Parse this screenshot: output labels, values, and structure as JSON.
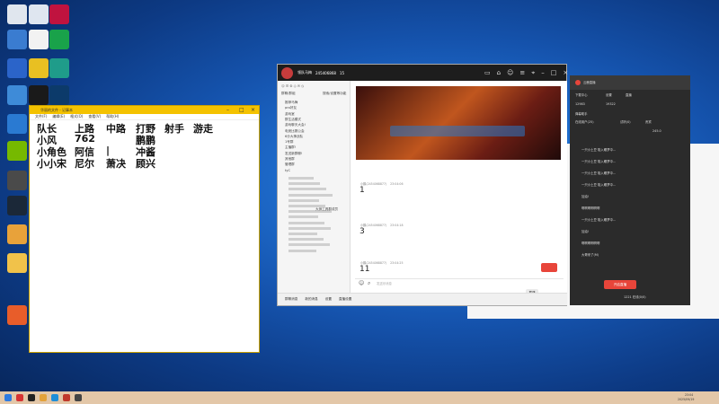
{
  "desktop": {
    "icons": [
      {
        "name": "recycle-bin-icon",
        "color": "#e0e6ee"
      },
      {
        "name": "document-icon",
        "color": "#dfe6f0"
      },
      {
        "name": "app-red-icon",
        "color": "#c0133f"
      },
      {
        "name": "pc-icon",
        "color": "#3a7cd0"
      },
      {
        "name": "folder-icon",
        "color": "#f2f2f2"
      },
      {
        "name": "qq-music-icon",
        "color": "#19a24a"
      },
      {
        "name": "shield-icon",
        "color": "#2b64c9"
      },
      {
        "name": "chrome-icon",
        "color": "#e8c022"
      },
      {
        "name": "game-icon",
        "color": "#1f9c8a"
      },
      {
        "name": "photo-icon",
        "color": "#3e8bd8"
      },
      {
        "name": "media-icon",
        "color": "#1a1a1a"
      },
      {
        "name": "power-icon",
        "color": "#0c3a6a"
      },
      {
        "name": "phone-icon",
        "color": "#2a7ad2"
      },
      {
        "name": "edge-icon",
        "color": "#2a9bd8"
      },
      {
        "name": "nvidia-icon",
        "color": "#76b900"
      },
      {
        "name": "colorful-icon",
        "color": "#d63b4b"
      },
      {
        "name": "gear-icon",
        "color": "#4a4a4a"
      },
      {
        "name": "bilibili-icon",
        "color": "#23aee5"
      },
      {
        "name": "steam-icon",
        "color": "#1b2838"
      },
      {
        "name": "netease-icon",
        "color": "#c62f2f"
      },
      {
        "name": "pubg-icon",
        "color": "#e8a23a"
      },
      {
        "name": "obs-icon",
        "color": "#302e31"
      },
      {
        "name": "folder2-icon",
        "color": "#f1c24a"
      },
      {
        "name": "app-red2-icon",
        "color": "#cc2222"
      },
      {
        "name": "app-orange-icon",
        "color": "#e85d2a"
      }
    ]
  },
  "notepad": {
    "title": "华丽的文件 - 记事本",
    "menu": [
      "文件(F)",
      "编辑(E)",
      "格式(O)",
      "查看(V)",
      "帮助(H)"
    ],
    "lines": [
      [
        "队长",
        "上路",
        "中路",
        "打野",
        "射手",
        "游走"
      ],
      [
        "小风",
        "762",
        "",
        "鹏鹏",
        "",
        ""
      ],
      [
        "小角色",
        "阿信",
        "|",
        "冲酱",
        "",
        ""
      ],
      [
        "小小宋",
        "尼尔",
        "萧决",
        "顾兴",
        "",
        ""
      ]
    ]
  },
  "qq": {
    "title": "领队马梅",
    "group_id": "245406868",
    "group_count": "15",
    "left_header": "群聊/群组",
    "left_search": "搜索/设置等功能",
    "groups": [
      "推荐马梅",
      "pro好友",
      "游戏室",
      "群生活模式",
      "游戏聊天大会!",
      "电竞比赛公会",
      "6分大神战队",
      "1号群",
      "主播群!",
      "发送新群聊!",
      "其他群",
      "管理群",
      "tyC"
    ],
    "members_label": "大师工具群成员",
    "msg_sender": "小鹏(2454068877)",
    "messages": [
      {
        "time": "23:04:06",
        "text": "1"
      },
      {
        "time": "23:04:18",
        "text": "3"
      },
      {
        "time": "23:04:25",
        "text": "11"
      }
    ],
    "input_placeholder": "发送@消息",
    "bottom_bar": [
      "群聊消息",
      "新的消息",
      "设置",
      "直播设置"
    ]
  },
  "stream": {
    "title": "云鹿直播",
    "tabs": [
      "下载中心",
      "设置",
      "直播"
    ],
    "fans": "12983",
    "online": "19322",
    "section": "弹幕助手",
    "sub_tabs": [
      "在线用户(25)",
      "试听(0)",
      "贵宾"
    ],
    "viewers": "245.0",
    "chat": [
      "一只小土豆 陷入睡梦中...",
      "一只小土豆 陷入睡梦中...",
      "一只小土豆 陷入睡梦中...",
      "一只小土豆 陷入睡梦中...",
      "加油!",
      "啊啊啊啊啊啊",
      "一只小土豆 陷入睡梦中...",
      "加油!",
      "啊啊啊啊啊啊",
      "大哥来了(M)"
    ],
    "start_button": "开启直播",
    "status": "1221 在线(0/0)"
  },
  "bgwin": {
    "items": [
      "已连接(不检测)",
      "房间连接"
    ]
  },
  "taskbar": {
    "time": "23:04",
    "date": "2025/09/19"
  }
}
